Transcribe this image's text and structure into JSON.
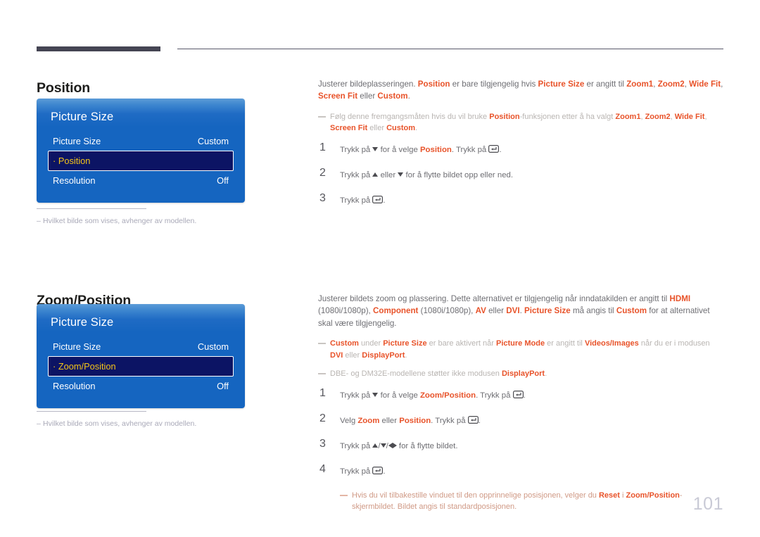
{
  "page": {
    "number": "101"
  },
  "header": {
    "rule_accent_color": "#454553",
    "rule_line_color": "#58586a"
  },
  "theme": {
    "accent_orange": "#e8532a",
    "panel_blue": "#1565c0",
    "panel_blue_top": "#5b9bd8",
    "selected_row_bg": "#0c1464",
    "selected_row_text": "#f5c518",
    "body_text": "#6e6e73",
    "note_text": "#b9b5b2",
    "page_number_color": "#c9cad6"
  },
  "sections": [
    {
      "id": "position",
      "title": "Position",
      "panel": {
        "header": "Picture Size",
        "rows": [
          {
            "label": "Picture Size",
            "value": "Custom",
            "selected": false,
            "bullet": false
          },
          {
            "label": "Position",
            "value": "",
            "selected": true,
            "bullet": true
          },
          {
            "label": "Resolution",
            "value": "Off",
            "selected": false,
            "bullet": false
          }
        ]
      },
      "panel_note": "Hvilket bilde som vises, avhenger av modellen.",
      "panel_note_dash": "–",
      "intro": {
        "t1": "Justerer bildeplasseringen. ",
        "b1": "Position",
        "t2": " er bare tilgjengelig hvis ",
        "b2": "Picture Size",
        "t3": " er angitt til ",
        "b3": "Zoom1",
        "t4": ", ",
        "b4": "Zoom2",
        "t5": ", ",
        "b5": "Wide Fit",
        "t6": ", ",
        "b6": "Screen Fit",
        "t7": " eller ",
        "b7": "Custom",
        "t8": "."
      },
      "note": {
        "t1": "Følg denne fremgangsmåten hvis du vil bruke ",
        "b1": "Position",
        "t2": "-funksjonen etter å ha valgt ",
        "b2": "Zoom1",
        "t3": ", ",
        "b3": "Zoom2",
        "t4": ", ",
        "b4": "Wide Fit",
        "t5": ", ",
        "b5": "Screen Fit",
        "t6": " eller ",
        "b6": "Custom",
        "t7": "."
      },
      "steps": [
        {
          "num": "1",
          "p1": "Trykk på ",
          "icon1": "triangle-down-icon",
          "p2": " for å velge ",
          "bold": "Position",
          "p3": ". Trykk på ",
          "icon2": "enter-key-icon",
          "p4": "."
        },
        {
          "num": "2",
          "p1": "Trykk på ",
          "icon1": "triangle-up-icon",
          "p2": " eller ",
          "icon2": "triangle-down-icon",
          "p3": " for å flytte bildet opp eller ned.",
          "bold": "",
          "p4": ""
        },
        {
          "num": "3",
          "p1": "Trykk på ",
          "icon1": "enter-key-icon",
          "p2": ".",
          "bold": "",
          "p3": "",
          "p4": ""
        }
      ]
    },
    {
      "id": "zoomposition",
      "title": "Zoom/Position",
      "panel": {
        "header": "Picture Size",
        "rows": [
          {
            "label": "Picture Size",
            "value": "Custom",
            "selected": false,
            "bullet": false
          },
          {
            "label": "Zoom/Position",
            "value": "",
            "selected": true,
            "bullet": true
          },
          {
            "label": "Resolution",
            "value": "Off",
            "selected": false,
            "bullet": false
          }
        ]
      },
      "panel_note": "Hvilket bilde som vises, avhenger av modellen.",
      "panel_note_dash": "–",
      "intro": {
        "t1": "Justerer bildets zoom og plassering. Dette alternativet er tilgjengelig når inndatakilden er angitt til ",
        "b1": "HDMI",
        "t2": " (1080i/1080p), ",
        "b2": "Component",
        "t3": " (1080i/1080p), ",
        "b3": "AV",
        "t4": " eller ",
        "b4": "DVI",
        "t5": ". ",
        "b5": "Picture Size",
        "t6": " må angis til ",
        "b6": "Custom",
        "t7": " for at alternativet skal være tilgjengelig."
      },
      "note1": {
        "b1": "Custom",
        "t1": " under ",
        "b2": "Picture Size",
        "t2": " er bare aktivert når ",
        "b3": "Picture Mode",
        "t3": " er angitt til ",
        "b4": "Videos/Images",
        "t4": " når du er i modusen ",
        "b5": "DVI",
        "t5": " eller ",
        "b6": "DisplayPort",
        "t6": "."
      },
      "note2": {
        "t1": "DBE- og DM32E-modellene støtter ikke modusen ",
        "b1": "DisplayPort",
        "t2": "."
      },
      "steps": [
        {
          "num": "1",
          "p1": "Trykk på ",
          "icon1": "triangle-down-icon",
          "p2": " for å velge ",
          "bold": "Zoom/Position",
          "p3": ". Trykk på ",
          "icon2": "enter-key-icon",
          "p4": "."
        },
        {
          "num": "2",
          "p1": "Velg ",
          "bold": "Zoom",
          "p2": " eller ",
          "bold2": "Position",
          "p3": ". Trykk på ",
          "icon2": "enter-key-icon",
          "p4": "."
        },
        {
          "num": "3",
          "p1": "Trykk på ",
          "icons": "triangle-up-icon / triangle-down-icon / triangle-left-icon / triangle-right-icon",
          "p2": " for å flytte bildet.",
          "bold": "",
          "p3": "",
          "p4": ""
        },
        {
          "num": "4",
          "p1": "Trykk på ",
          "icon1": "enter-key-icon",
          "p2": ".",
          "bold": "",
          "p3": "",
          "p4": ""
        }
      ],
      "final_note": {
        "t1": "Hvis du vil tilbakestille vinduet til den opprinnelige posisjonen, velger du ",
        "b1": "Reset",
        "t2": " i ",
        "b2": "Zoom/Position",
        "t3": "-skjermbildet. Bildet angis til standardposisjonen."
      }
    }
  ]
}
